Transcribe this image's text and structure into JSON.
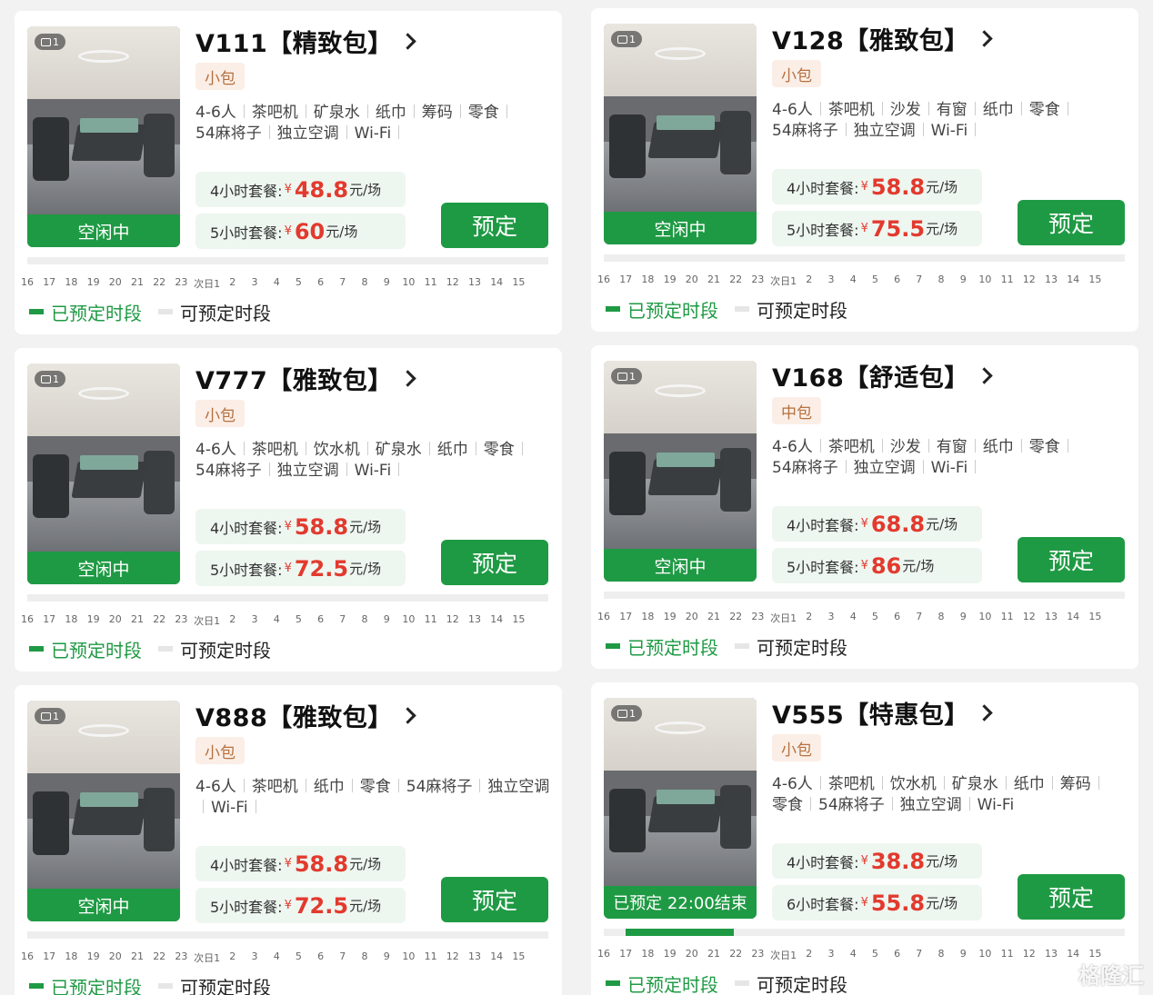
{
  "rooms": [
    {
      "title": "V111【精致包】",
      "size": "小包",
      "amenities": [
        "4-6人",
        "茶吧机",
        "矿泉水",
        "纸巾",
        "筹码",
        "零食",
        "54麻将子",
        "独立空调",
        "Wi-Fi"
      ],
      "image_count": "1",
      "status": "空闲中",
      "packages": [
        {
          "label": "4小时套餐:",
          "yen": "¥",
          "price": "48.8",
          "unit": "元/场"
        },
        {
          "label": "5小时套餐:",
          "yen": "¥",
          "price": "60",
          "unit": "元/场"
        }
      ],
      "book_label": "预定",
      "booked_ranges": []
    },
    {
      "title": "V128【雅致包】",
      "size": "小包",
      "amenities": [
        "4-6人",
        "茶吧机",
        "沙发",
        "有窗",
        "纸巾",
        "零食",
        "54麻将子",
        "独立空调",
        "Wi-Fi"
      ],
      "image_count": "1",
      "status": "空闲中",
      "packages": [
        {
          "label": "4小时套餐:",
          "yen": "¥",
          "price": "58.8",
          "unit": "元/场"
        },
        {
          "label": "5小时套餐:",
          "yen": "¥",
          "price": "75.5",
          "unit": "元/场"
        }
      ],
      "book_label": "预定",
      "booked_ranges": []
    },
    {
      "title": "V777【雅致包】",
      "size": "小包",
      "amenities": [
        "4-6人",
        "茶吧机",
        "饮水机",
        "矿泉水",
        "纸巾",
        "零食",
        "54麻将子",
        "独立空调",
        "Wi-Fi"
      ],
      "image_count": "1",
      "status": "空闲中",
      "packages": [
        {
          "label": "4小时套餐:",
          "yen": "¥",
          "price": "58.8",
          "unit": "元/场"
        },
        {
          "label": "5小时套餐:",
          "yen": "¥",
          "price": "72.5",
          "unit": "元/场"
        }
      ],
      "book_label": "预定",
      "booked_ranges": []
    },
    {
      "title": "V168【舒适包】",
      "size": "中包",
      "amenities": [
        "4-6人",
        "茶吧机",
        "沙发",
        "有窗",
        "纸巾",
        "零食",
        "54麻将子",
        "独立空调",
        "Wi-Fi"
      ],
      "image_count": "1",
      "status": "空闲中",
      "packages": [
        {
          "label": "4小时套餐:",
          "yen": "¥",
          "price": "68.8",
          "unit": "元/场"
        },
        {
          "label": "5小时套餐:",
          "yen": "¥",
          "price": "86",
          "unit": "元/场"
        }
      ],
      "book_label": "预定",
      "booked_ranges": []
    },
    {
      "title": "V888【雅致包】",
      "size": "小包",
      "amenities": [
        "4-6人",
        "茶吧机",
        "纸巾",
        "零食",
        "54麻将子",
        "独立空调",
        "Wi-Fi"
      ],
      "image_count": "1",
      "status": "空闲中",
      "packages": [
        {
          "label": "4小时套餐:",
          "yen": "¥",
          "price": "58.8",
          "unit": "元/场"
        },
        {
          "label": "5小时套餐:",
          "yen": "¥",
          "price": "72.5",
          "unit": "元/场"
        }
      ],
      "book_label": "预定",
      "booked_ranges": []
    },
    {
      "title": "V555【特惠包】",
      "size": "小包",
      "amenities": [
        "4-6人",
        "茶吧机",
        "饮水机",
        "矿泉水",
        "纸巾",
        "筹码",
        "零食",
        "54麻将子",
        "独立空调",
        "Wi-Fi"
      ],
      "image_count": "1",
      "status": "已预定 22:00结束",
      "packages": [
        {
          "label": "4小时套餐:",
          "yen": "¥",
          "price": "38.8",
          "unit": "元/场"
        },
        {
          "label": "6小时套餐:",
          "yen": "¥",
          "price": "55.8",
          "unit": "元/场"
        }
      ],
      "book_label": "预定",
      "booked_ranges": [
        [
          17,
          22
        ]
      ]
    }
  ],
  "timeline_ticks": [
    "16",
    "17",
    "18",
    "19",
    "20",
    "21",
    "22",
    "23",
    "次日1",
    "2",
    "3",
    "4",
    "5",
    "6",
    "7",
    "8",
    "9",
    "10",
    "11",
    "12",
    "13",
    "14",
    "15"
  ],
  "legend": {
    "booked": "已预定时段",
    "available": "可预定时段"
  },
  "colors": {
    "primary_green": "#1f9a44",
    "price_red": "#e23a2e",
    "tag_bg": "#fbeee6",
    "tag_text": "#b5703f"
  },
  "watermark": "格隆汇"
}
